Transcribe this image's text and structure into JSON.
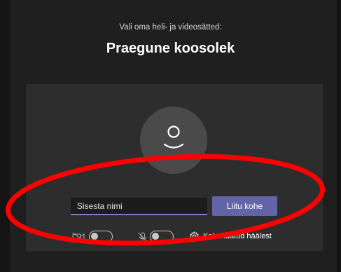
{
  "header": {
    "subtitle": "Vali oma heli- ja videosätted:",
    "title": "Praegune koosolek"
  },
  "preview": {
    "avatar_icon": "person-icon"
  },
  "join_form": {
    "name_placeholder": "Sisesta nimi",
    "join_label": "Liitu kohe"
  },
  "controls": {
    "camera_icon": "camera-off-icon",
    "camera_enabled": false,
    "microphone_icon": "microphone-off-icon",
    "microphone_enabled": false,
    "settings_icon": "gear-icon",
    "device_settings_label": "Kohandatud häälest"
  },
  "annotation": {
    "shape": "ellipse",
    "color": "#ff0000"
  },
  "colors": {
    "background": "#1f1f1f",
    "panel": "#2d2d2d",
    "accent": "#6264a7"
  }
}
